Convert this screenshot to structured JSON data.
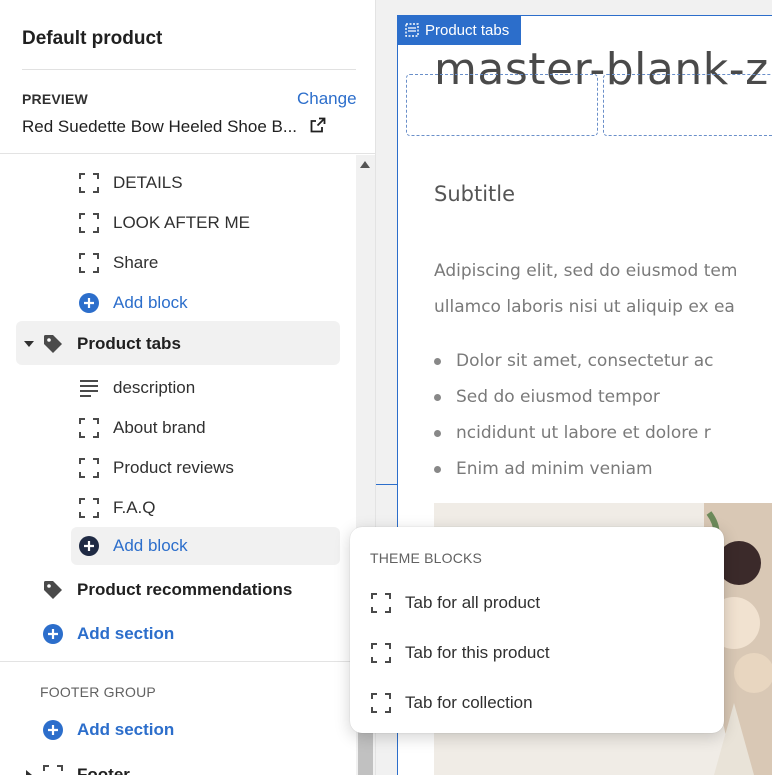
{
  "sidebar": {
    "title": "Default product",
    "preview_label": "PREVIEW",
    "change_label": "Change",
    "preview_product": "Red Suedette Bow Heeled Shoe B...",
    "blocks_before": [
      "DETAILS",
      "LOOK AFTER ME",
      "Share"
    ],
    "add_block_label": "Add block",
    "product_tabs_label": "Product tabs",
    "tab_blocks": [
      "description",
      "About brand",
      "Product reviews",
      "F.A.Q"
    ],
    "add_block_label_2": "Add block",
    "product_recommendations_label": "Product recommendations",
    "add_section_label": "Add section",
    "footer_group_label": "FOOTER GROUP",
    "footer_add_section_label": "Add section",
    "footer_label": "Footer"
  },
  "preview": {
    "badge_label": "Product tabs",
    "heading": "master-blank-zm",
    "subtitle": "Subtitle",
    "para_lines": [
      "Adipiscing elit, sed do eiusmod tem",
      "ullamco laboris nisi ut aliquip ex ea"
    ],
    "bullets": [
      "Dolor sit amet, consectetur ac",
      "Sed do eiusmod tempor",
      "ncididunt ut labore et dolore r",
      "Enim ad minim veniam"
    ]
  },
  "popover": {
    "heading": "THEME BLOCKS",
    "items": [
      "Tab for all product",
      "Tab for this product",
      "Tab for collection"
    ]
  },
  "colors": {
    "accent": "#2c6ecb",
    "selected_bg": "#f1f1f1"
  }
}
